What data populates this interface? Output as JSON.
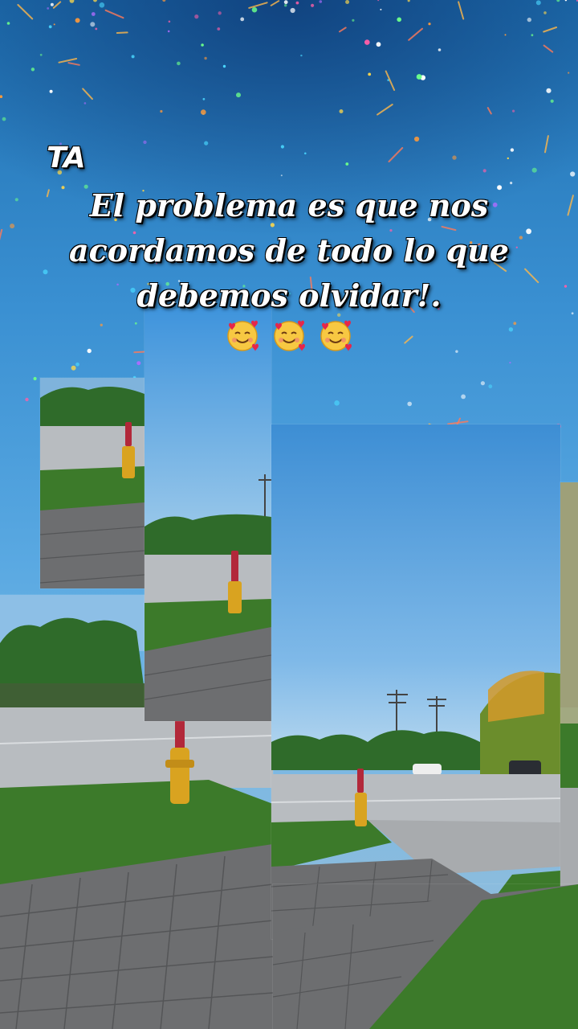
{
  "overlay": {
    "tag": "TA",
    "quote_lines": [
      "El problema es que nos",
      "acordamos de todo lo que",
      "debemos olvidar!."
    ],
    "emoji_count": 3,
    "emoji_name": "smiling-face-with-hearts-icon"
  },
  "colors": {
    "sky_top": "#1e6fb0",
    "sky_mid": "#4a9ddc",
    "grass": "#3c7a2a",
    "trees": "#2f6b2a",
    "road": "#b8bcc0",
    "pavers": "#6d6e70",
    "hydrant": "#d9a320",
    "hydrant_cap": "#b2283a",
    "text": "#ffffff"
  }
}
